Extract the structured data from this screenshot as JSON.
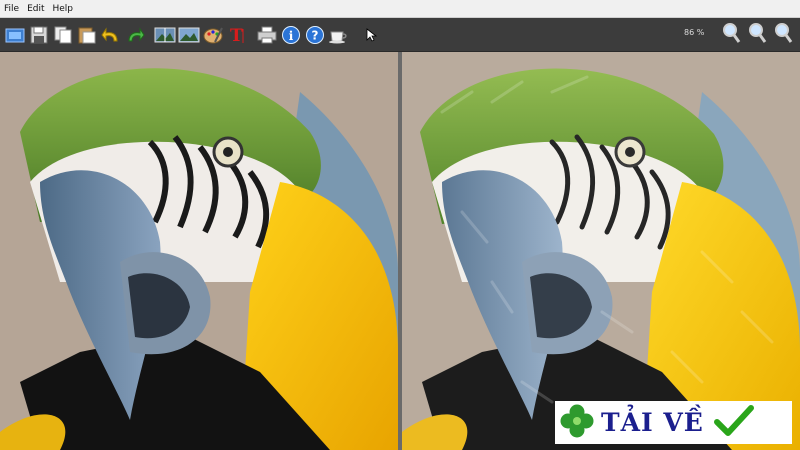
{
  "menu": {
    "items": [
      "File",
      "Edit",
      "Help"
    ]
  },
  "toolbar": {
    "zoom_level": "86 %",
    "icons": [
      "open-image-icon",
      "save-icon",
      "copy-icon",
      "paste-icon",
      "undo-icon",
      "redo-icon",
      "compare-view-icon",
      "image-view-icon",
      "palette-icon",
      "text-tool-icon",
      "print-icon",
      "info-icon",
      "help-icon",
      "coffee-icon"
    ]
  },
  "badge": {
    "text": "TẢI VỀ"
  },
  "colors": {
    "toolbar_bg": "#3c3c3c",
    "menu_bg": "#f0f0f0",
    "badge_text": "#1b1f8e",
    "check": "#2aa51a"
  }
}
